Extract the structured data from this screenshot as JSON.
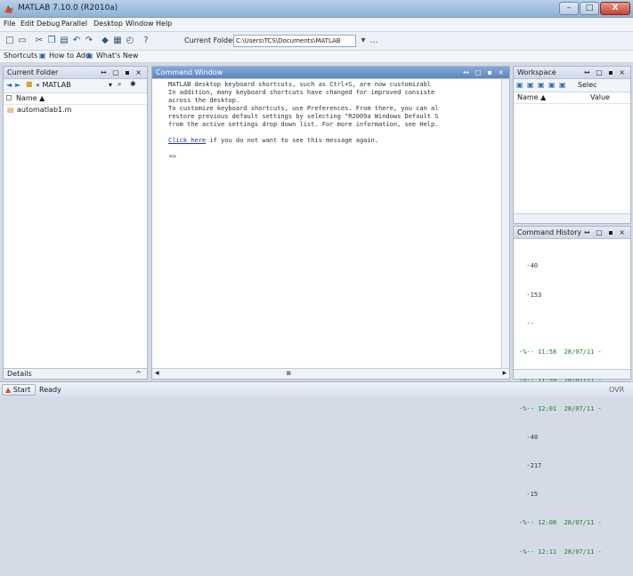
{
  "window": {
    "title": "MATLAB 7.10.0 (R2010a)",
    "min": "–",
    "max": "□",
    "close": "X"
  },
  "menu": [
    "File",
    "Edit",
    "Debug",
    "Parallel",
    "Desktop",
    "Window",
    "Help"
  ],
  "toolbar": {
    "current_folder_label": "Current Folder:",
    "current_folder_value": "C:\\Users\\TCS\\Documents\\MATLAB",
    "dropdown": "▾",
    "browse": "…"
  },
  "shortcuts": {
    "shortcuts": "Shortcuts",
    "how_to_add": "How to Add",
    "whats_new": "What's New"
  },
  "current_folder": {
    "title": "Current Folder",
    "path": "« MATLAB",
    "col_name": "Name ▲",
    "file": "automatlab1.m",
    "details": "Details"
  },
  "command_window": {
    "title": "Command Window",
    "lines": [
      "MATLAB desktop keyboard shortcuts, such as Ctrl+S, are now customizabl",
      "In addition, many keyboard shortcuts have changed for improved consiste",
      "across the desktop.",
      "",
      "To customize keyboard shortcuts, use Preferences. From there, you can al",
      "restore previous default settings by selecting \"R2009a Windows Default S",
      "from the active settings drop down list. For more information, see Help."
    ],
    "click_here": "Click here",
    "click_rest": " if you do not want to see this message again.",
    "prompt_fx": "fx",
    "prompt": ">>"
  },
  "workspace": {
    "title": "Workspace",
    "select": "Selec",
    "col_name": "Name ▲",
    "col_value": "Value"
  },
  "history": {
    "title": "Command History",
    "lines": [
      {
        "text": "  -40",
        "green": false
      },
      {
        "text": "  -153",
        "green": false
      },
      {
        "text": "  --",
        "green": false
      },
      {
        "text": "-%-- 11:58  28/07/11 -",
        "green": true
      },
      {
        "text": "-%-- 11:59  28/07/11 -",
        "green": true
      },
      {
        "text": "-%-- 12:01  28/07/11 -",
        "green": true
      },
      {
        "text": "  -40",
        "green": false
      },
      {
        "text": "  -217",
        "green": false
      },
      {
        "text": "  -15",
        "green": false
      },
      {
        "text": "-%-- 12:08  28/07/11 -",
        "green": true
      },
      {
        "text": "-%-- 12:11  28/07/11 -",
        "green": true
      }
    ]
  },
  "status": {
    "start": "Start",
    "ready": "Ready",
    "ovr": "OVR"
  }
}
